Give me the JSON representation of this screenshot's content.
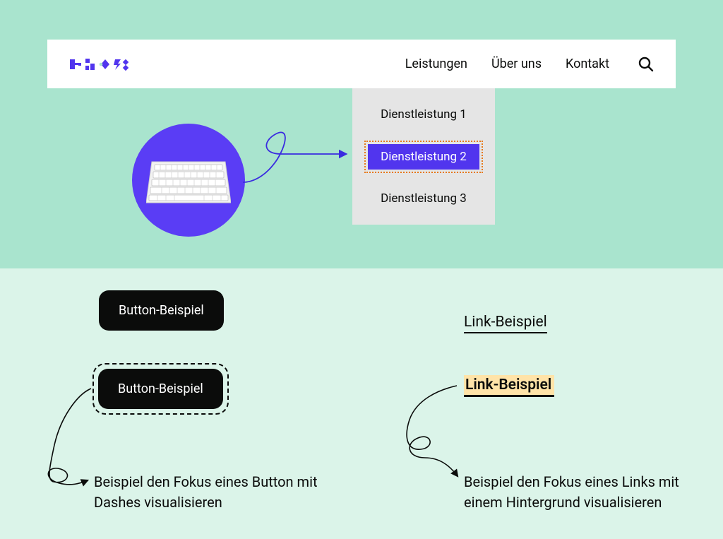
{
  "nav": {
    "items": [
      "Leistungen",
      "Über uns",
      "Kontakt"
    ]
  },
  "dropdown": {
    "items": [
      "Dienstleistung 1",
      "Dienstleistung 2",
      "Dienstleistung 3"
    ],
    "focused_index": 1
  },
  "buttons": {
    "plain_label": "Button-Beispiel",
    "focused_label": "Button-Beispiel"
  },
  "links": {
    "plain_label": "Link-Beispiel",
    "focused_label": "Link-Beispiel"
  },
  "captions": {
    "button": "Beispiel den Fokus eines Button mit Dashes visualisieren",
    "link": "Beispiel den Fokus eines Links mit einem Hintergrund visualisieren"
  },
  "colors": {
    "indigo": "#5135ee",
    "focus_outline": "#e77918",
    "link_highlight": "#ffe3a8"
  }
}
